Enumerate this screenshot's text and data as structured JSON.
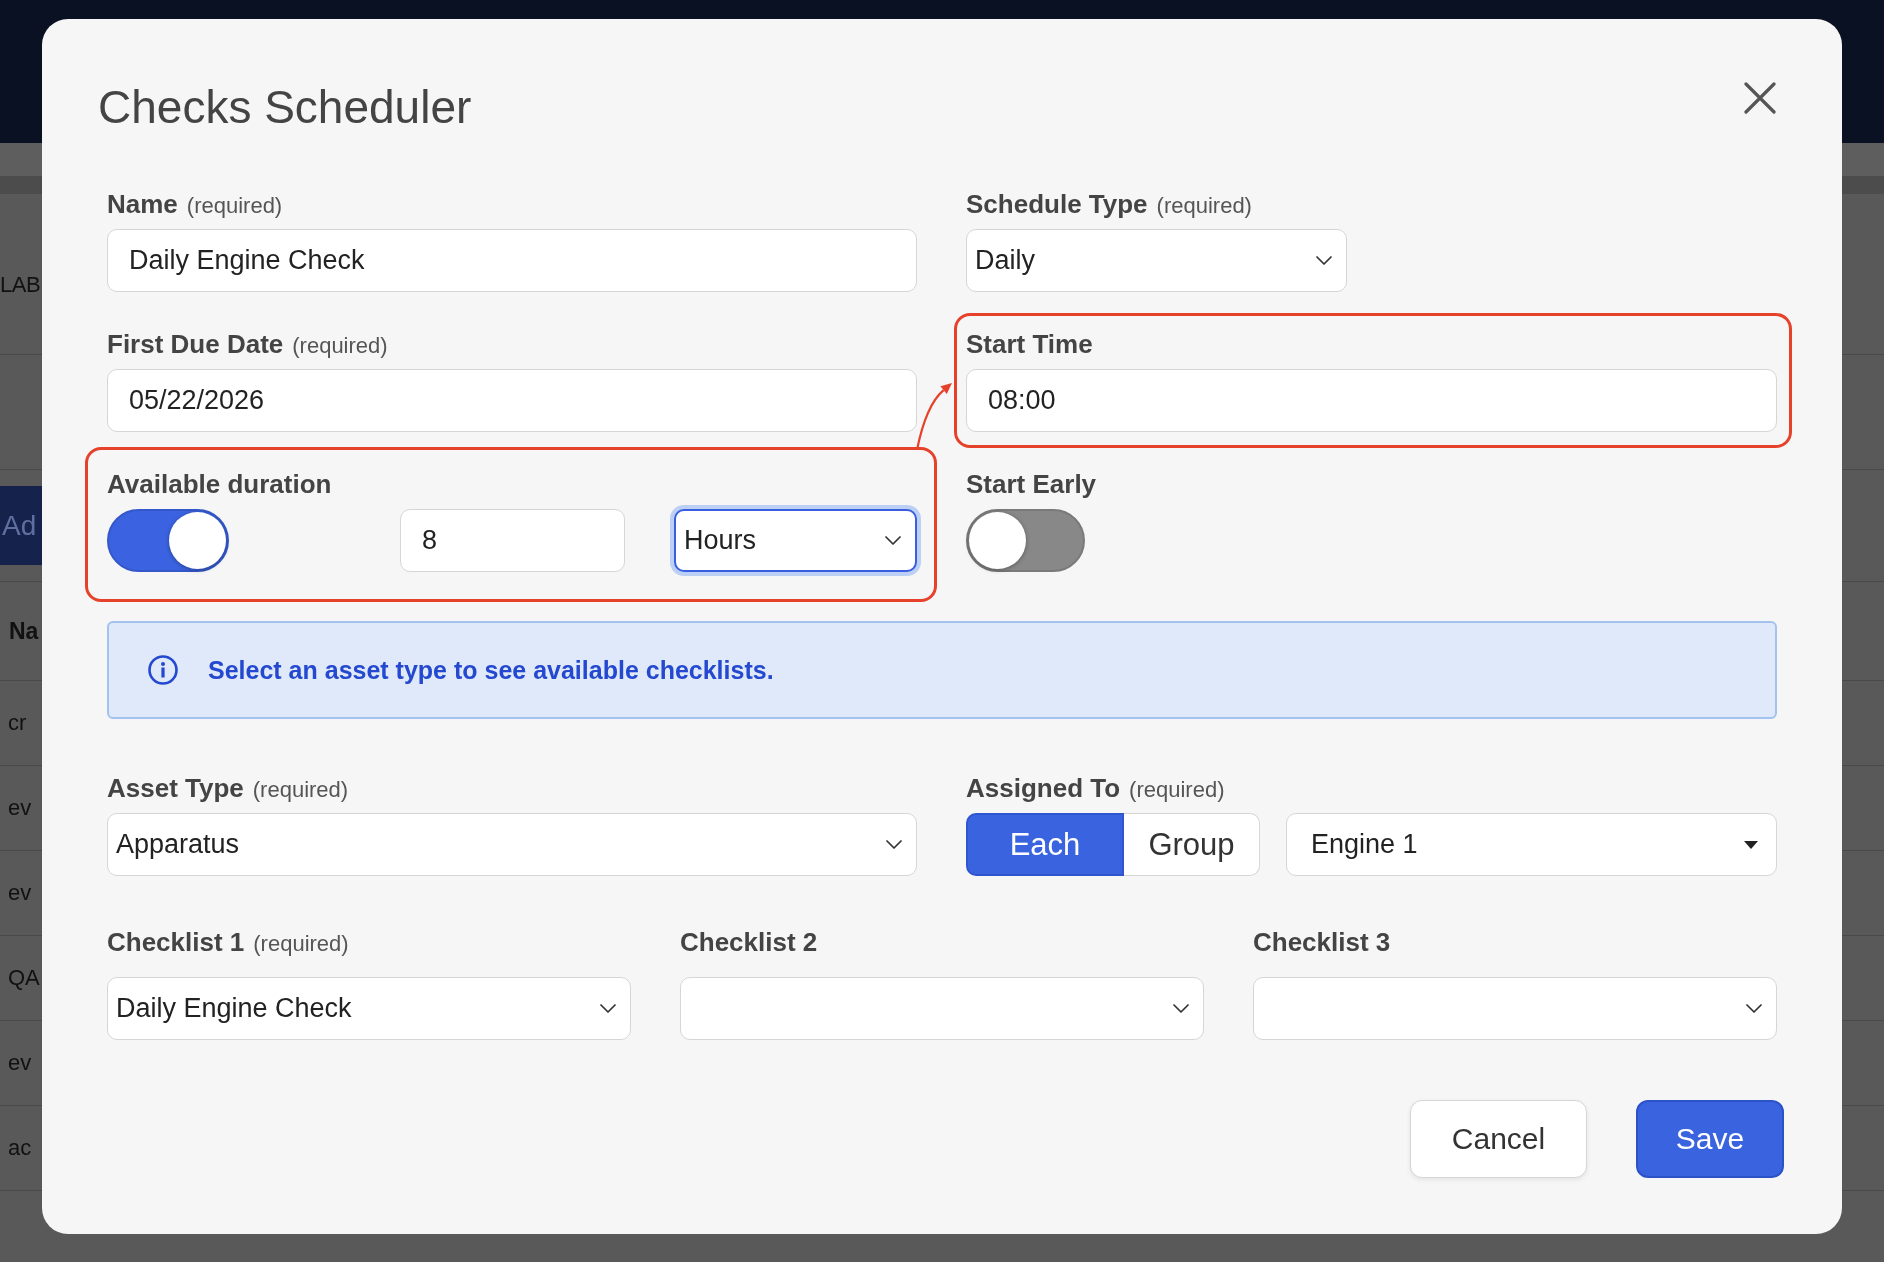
{
  "background_page": {
    "section_label": "LAB",
    "add_button": "Ad",
    "table_header": "Na",
    "rows": [
      {
        "cells": [
          "cr"
        ]
      },
      {
        "cells": [
          "ev"
        ]
      },
      {
        "cells": [
          "ev"
        ]
      },
      {
        "cells": [
          "QA"
        ]
      },
      {
        "cells": [
          "ev"
        ]
      },
      {
        "cells": [
          "ac"
        ]
      }
    ]
  },
  "dialog": {
    "title": "Checks Scheduler",
    "fields": [
      {
        "kind": "text",
        "label": "Name",
        "note": "(required)",
        "value": "Daily Engine Check",
        "highlighted": false
      },
      {
        "kind": "select",
        "label": "Schedule Type",
        "note": "(required)",
        "value": "Daily",
        "highlighted": false
      },
      {
        "kind": "text",
        "label": "First Due Date",
        "note": "(required)",
        "value": "05/22/2026",
        "highlighted": false
      },
      {
        "kind": "text",
        "label": "Start Time",
        "value": "08:00",
        "highlighted": true
      },
      {
        "kind": "duration",
        "label": "Available duration",
        "on": true,
        "amount": "8",
        "unit": "Hours",
        "unit_focused": true,
        "highlighted": true
      },
      {
        "kind": "toggle",
        "label": "Start Early",
        "on": false,
        "highlighted": false
      }
    ],
    "notice": {
      "text": "Select an asset type to see available checklists."
    },
    "asset_type": {
      "label": "Asset Type",
      "note": "(required)",
      "value": "Apparatus"
    },
    "assigned_to": {
      "label": "Assigned To",
      "note": "(required)",
      "options": [
        {
          "label": "Each",
          "selected": true
        },
        {
          "label": "Group",
          "selected": false
        }
      ],
      "value": "Engine 1"
    },
    "checklists": [
      {
        "label": "Checklist 1",
        "note": "(required)",
        "value": "Daily Engine Check"
      },
      {
        "label": "Checklist 2"
      },
      {
        "label": "Checklist 3"
      }
    ],
    "buttons": [
      {
        "label": "Cancel",
        "kind": "secondary"
      },
      {
        "label": "Save",
        "kind": "primary"
      }
    ]
  }
}
